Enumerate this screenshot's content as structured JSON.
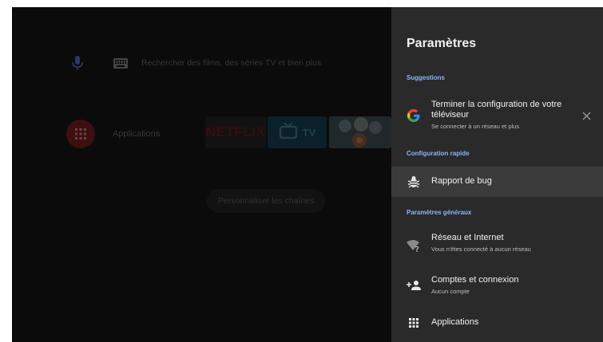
{
  "home": {
    "search_placeholder": "Rechercher des films, des séries TV et bien plus",
    "apps_label": "Applications",
    "netflix_label": "NETFLIX",
    "tv_label": "TV",
    "customize_channels": "Personnaliser les chaînes"
  },
  "settings": {
    "title": "Paramètres",
    "sections": {
      "suggestions": "Suggestions",
      "quick": "Configuration rapide",
      "general": "Paramètres généraux"
    },
    "suggestion": {
      "title": "Terminer la configuration de votre téléviseur",
      "subtitle": "Se connecter à un réseau et plus",
      "icon": "google-icon"
    },
    "bug_report": {
      "title": "Rapport de bug",
      "icon": "bug-icon"
    },
    "network": {
      "title": "Réseau et Internet",
      "subtitle": "Vous n'êtes connecté à aucun réseau",
      "icon": "wifi-off-icon"
    },
    "accounts": {
      "title": "Comptes et connexion",
      "subtitle": "Aucun compte",
      "icon": "add-account-icon"
    },
    "applications": {
      "title": "Applications",
      "icon": "apps-grid-icon"
    }
  },
  "colors": {
    "panel_bg": "#2a2a2b",
    "section_accent": "#8ab4f8",
    "highlight_row": "#3b3b3c"
  }
}
